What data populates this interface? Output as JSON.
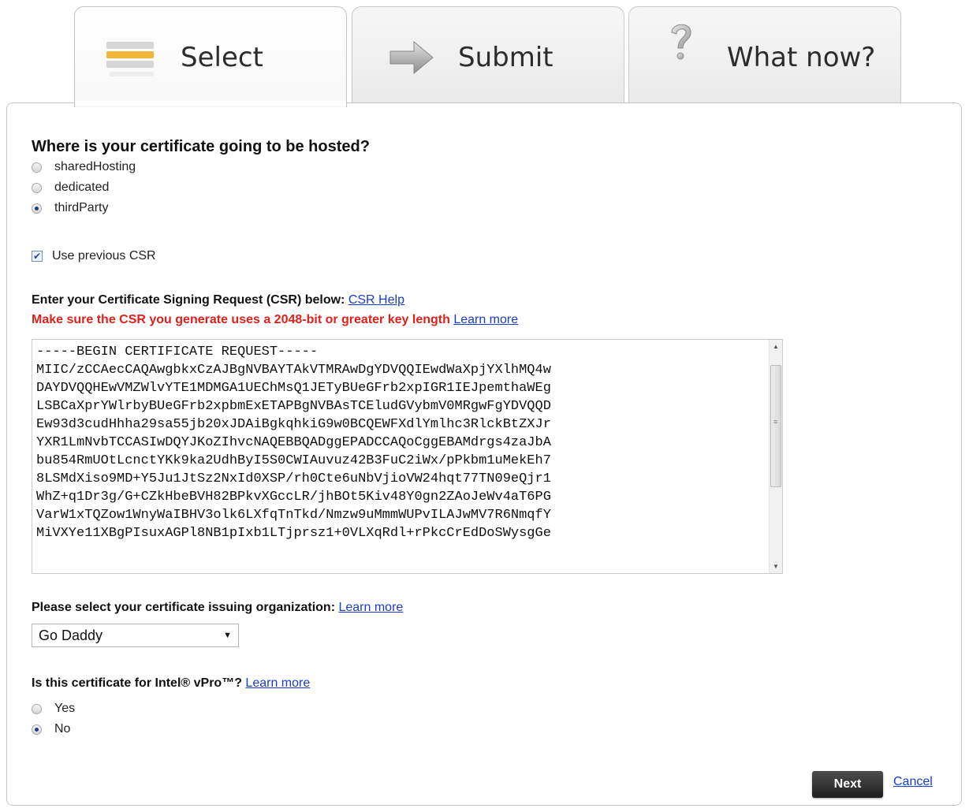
{
  "tabs": [
    {
      "label": "Select",
      "icon": "list-icon",
      "active": true
    },
    {
      "label": "Submit",
      "icon": "arrow-right-icon",
      "active": false
    },
    {
      "label": "What now?",
      "icon": "question-icon",
      "active": false
    }
  ],
  "hosting": {
    "question": "Where is your certificate going to be hosted?",
    "options": [
      "sharedHosting",
      "dedicated",
      "thirdParty"
    ],
    "selected": "thirdParty"
  },
  "use_previous_csr": {
    "label": "Use previous CSR",
    "checked": true
  },
  "csr": {
    "prompt": "Enter your Certificate Signing Request (CSR) below:",
    "help_link": "CSR Help",
    "warning": "Make sure the CSR you generate uses a 2048-bit or greater key length",
    "learn_more": "Learn more",
    "text": "-----BEGIN CERTIFICATE REQUEST-----\nMIIC/zCCAecCAQAwgbkxCzAJBgNVBAYTAkVTMRAwDgYDVQQIEwdWaXpjYXlhMQ4w\nDAYDVQQHEwVMZWlvYTE1MDMGA1UEChMsQ1JETyBUeGFrb2xpIGR1IEJpemthaWEg\nLSBCaXprYWlrbyBUeGFrb2xpbmExETAPBgNVBAsTCEludGVybmV0MRgwFgYDVQQD\nEw93d3cudHhha29sa55jb20xJDAiBgkqhkiG9w0BCQEWFXdlYmlhc3RlckBtZXJr\nYXR1LmNvbTCCASIwDQYJKoZIhvcNAQEBBQADggEPADCCAQoCggEBAMdrgs4zaJbA\nbu854RmUOtLcnctYKk9ka2UdhByI5S0CWIAuvuz42B3FuC2iWx/pPkbm1uMekEh7\n8LSMdXiso9MD+Y5Ju1JtSz2NxId0XSP/rh0Cte6uNbVjioVW24hqt77TN09eQjr1\nWhZ+q1Dr3g/G+CZkHbeBVH82BPkvXGccLR/jhBOt5Kiv48Y0gn2ZAoJeWv4aT6PG\nVarW1xTQZow1WnyWaIBHV3olk6LXfqTnTkd/Nmzw9uMmmWUPvILAJwMV7R6NmqfY\nMiVXYe11XBgPIsuxAGPl8NB1pIxb1LTjprsz1+0VLXqRdl+rPkcCrEdDoSWysgGe"
  },
  "issuer": {
    "prompt": "Please select your certificate issuing organization:",
    "learn_more": "Learn more",
    "selected": "Go Daddy"
  },
  "vpro": {
    "prompt": "Is this certificate for Intel® vPro™?",
    "learn_more": "Learn more",
    "options": [
      "Yes",
      "No"
    ],
    "selected": "No"
  },
  "actions": {
    "next": "Next",
    "cancel": "Cancel"
  }
}
